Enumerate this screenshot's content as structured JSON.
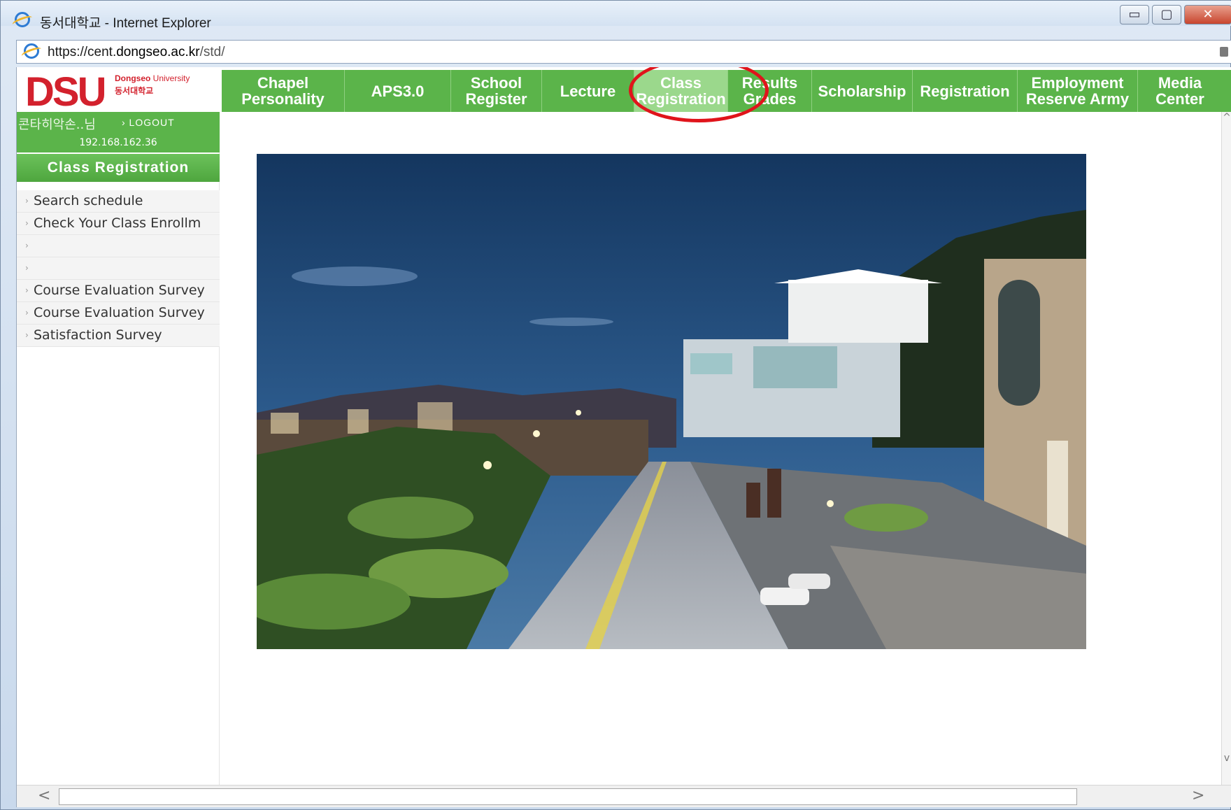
{
  "window": {
    "title": "동서대학교 - Internet Explorer",
    "controls": {
      "minimize": "▭",
      "maximize": "▢",
      "close": "✕"
    }
  },
  "addressbar": {
    "url_scheme": "https://cent.",
    "url_host": "dongseo.ac.kr",
    "url_path": "/std/"
  },
  "brand": {
    "logo_text": "DSU",
    "university_en_bold": "Dongseo",
    "university_en_rest": " University",
    "university_kr": "동서대학교"
  },
  "nav": {
    "items": [
      {
        "line1": "Chapel",
        "line2": "Personality"
      },
      {
        "line1": "APS3.0",
        "line2": ""
      },
      {
        "line1": "School",
        "line2": "Register"
      },
      {
        "line1": "Lecture",
        "line2": ""
      },
      {
        "line1": "Class",
        "line2": "Registration"
      },
      {
        "line1": "Results",
        "line2": "Grades"
      },
      {
        "line1": "Scholarship",
        "line2": ""
      },
      {
        "line1": "Registration",
        "line2": ""
      },
      {
        "line1": "Employment",
        "line2": "Reserve Army"
      },
      {
        "line1": "Media",
        "line2": "Center"
      }
    ],
    "active_index": 4,
    "accent_color": "#5bb44a",
    "highlight_color": "#e0141b"
  },
  "sidebar": {
    "user_name": "콘타히악손..님",
    "logout_label": "› LOGOUT",
    "ip_address": "192.168.162.36",
    "section_title": "Class Registration",
    "menu": [
      {
        "label": "Search schedule"
      },
      {
        "label": "Check Your Class Enrollm"
      },
      {
        "label": ""
      },
      {
        "label": ""
      },
      {
        "label": "Course Evaluation Survey"
      },
      {
        "label": "Course Evaluation Survey"
      },
      {
        "label": "Satisfaction Survey"
      }
    ]
  },
  "scroll": {
    "left_arrow": "<",
    "right_arrow": ">",
    "up_arrow": "^",
    "down_arrow": "v"
  }
}
